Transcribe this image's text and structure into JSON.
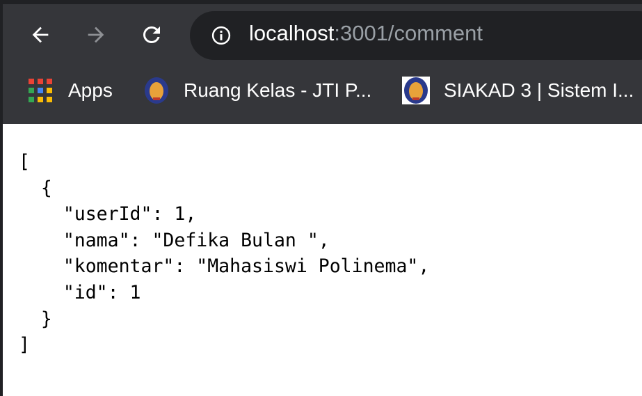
{
  "browser": {
    "url_host": "localhost",
    "url_rest": ":3001/comment",
    "bookmarks": [
      {
        "label": "Apps",
        "icon": "apps-grid-icon"
      },
      {
        "label": "Ruang Kelas - JTI P...",
        "icon": "polinema-logo-icon"
      },
      {
        "label": "SIAKAD 3 | Sistem I...",
        "icon": "polinema-logo-icon"
      }
    ]
  },
  "content": {
    "lines": [
      "[",
      "  {",
      "    \"userId\": 1,",
      "    \"nama\": \"Defika Bulan \",",
      "    \"komentar\": \"Mahasiswi Polinema\",",
      "    \"id\": 1",
      "  }",
      "]"
    ]
  }
}
